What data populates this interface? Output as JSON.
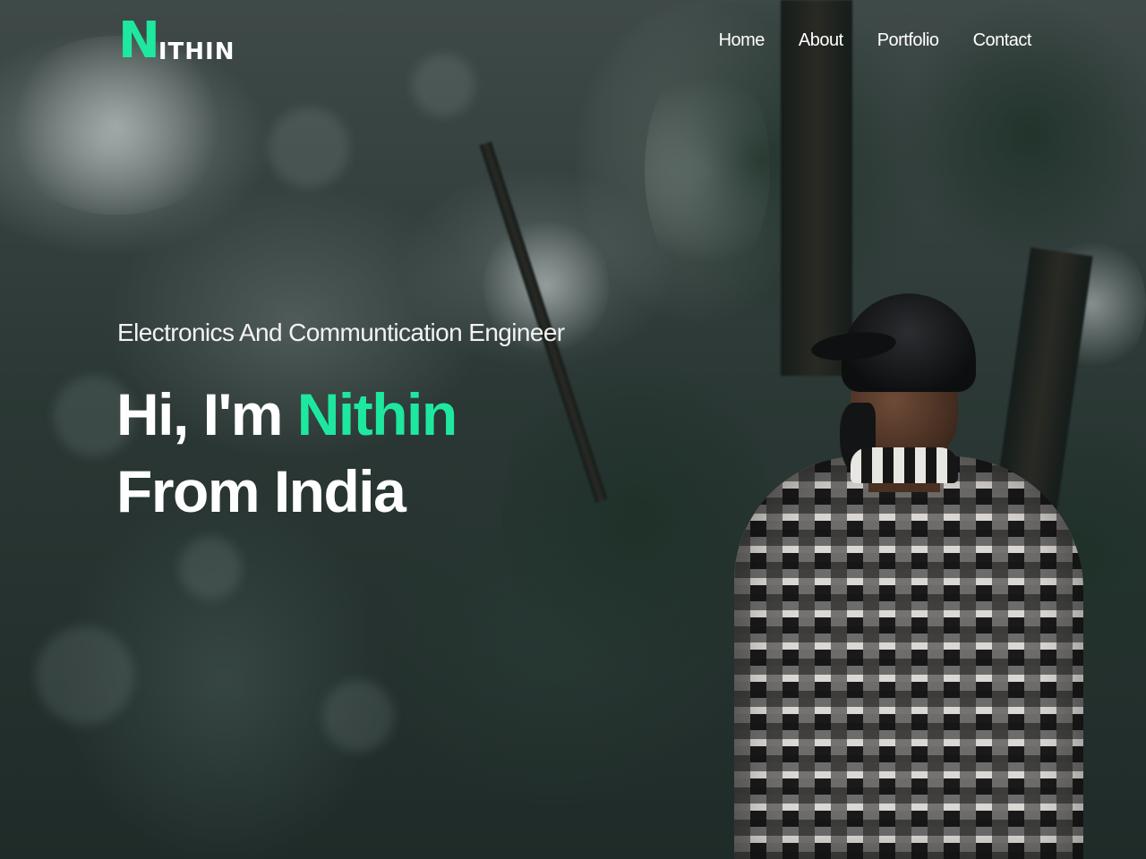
{
  "brand": {
    "initial": "N",
    "rest": "ITHIN",
    "accent_color": "#1ee8a0"
  },
  "nav": {
    "items": [
      {
        "label": "Home"
      },
      {
        "label": "About"
      },
      {
        "label": "Portfolio"
      },
      {
        "label": "Contact"
      }
    ]
  },
  "hero": {
    "tagline": "Electronics And Communtication Engineer",
    "greeting": "Hi, I'm",
    "name": "Nithin",
    "subline": "From India"
  }
}
